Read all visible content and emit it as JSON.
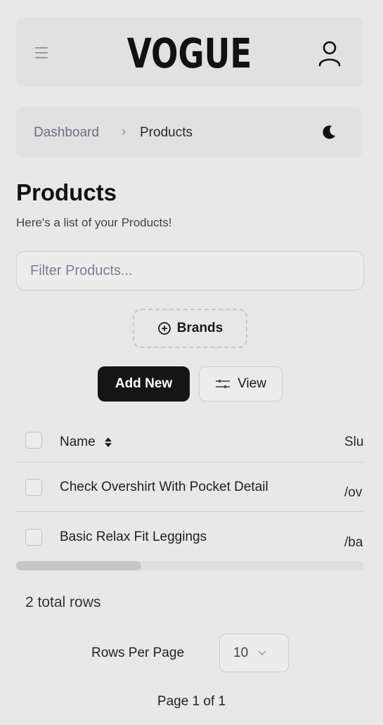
{
  "header": {
    "logo": "VOGUE"
  },
  "breadcrumb": {
    "items": [
      "Dashboard",
      "Products"
    ],
    "separator": "›"
  },
  "page": {
    "title": "Products",
    "subtitle": "Here's a list of your Products!"
  },
  "filter": {
    "placeholder": "Filter Products..."
  },
  "toolbar": {
    "brands_label": "Brands",
    "add_new_label": "Add New",
    "view_label": "View"
  },
  "table": {
    "columns": [
      "Name",
      "Slu"
    ],
    "rows": [
      {
        "name": "Check Overshirt With Pocket Detail",
        "slug": "/ov"
      },
      {
        "name": "Basic Relax Fit Leggings",
        "slug": "/ba"
      }
    ],
    "horizontal_scroll_fraction": 0.36
  },
  "pagination": {
    "total_rows": "2 total rows",
    "rows_per_page_label": "Rows Per Page",
    "rows_per_page_value": "10",
    "page_info": "Page 1 of 1"
  },
  "colors": {
    "background": "#e8e8e8",
    "primary_button": "#151515"
  },
  "icons": [
    "menu-icon",
    "user-icon",
    "chevron-right-icon",
    "moon-icon",
    "plus-circle-icon",
    "sliders-icon",
    "sort-icon",
    "chevron-down-icon"
  ]
}
